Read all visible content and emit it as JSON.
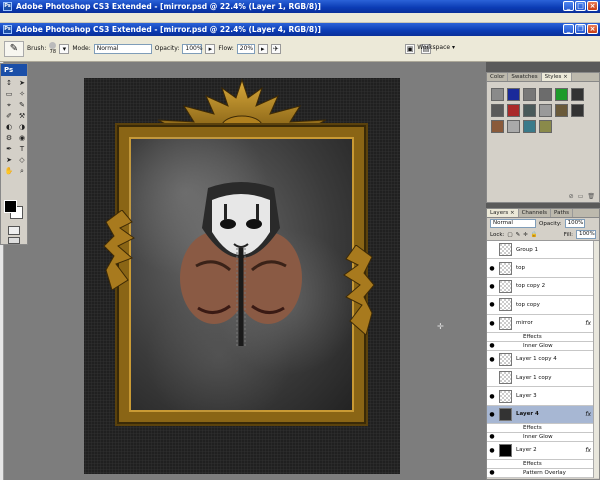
{
  "app": {
    "title": "Adobe Photoshop CS3 Extended - [mirror.psd @ 22.4% (Layer 1, RGB/8)]",
    "doc_title": "Adobe Photoshop CS3 Extended - [mirror.psd @ 22.4% (Layer 4, RGB/8)]"
  },
  "options": {
    "brush_label": "Brush:",
    "brush_size": "78",
    "mode_label": "Mode:",
    "mode_value": "Normal",
    "opacity_label": "Opacity:",
    "opacity_value": "100%",
    "flow_label": "Flow:",
    "flow_value": "20%",
    "workspace_label": "Workspace ▾"
  },
  "toolbox": {
    "logo": "Ps",
    "tools": [
      "↕",
      "➤",
      "▭",
      "✧",
      "⌖",
      "✎",
      "✐",
      "⚒",
      "◐",
      "◑",
      "⚙",
      "◉",
      "✒",
      "T",
      "➤",
      "◇",
      "✋",
      "⌕"
    ]
  },
  "styles_panel": {
    "tabs": [
      "Color",
      "Swatches",
      "Styles ×"
    ],
    "swatches": [
      "#8a8a8a",
      "#1a2a9a",
      "#777777",
      "#6c6c6c",
      "#1e9a2a",
      "#333333",
      "#5a5a5a",
      "#aa2a2a",
      "#4a5a5a",
      "#9a9a9a",
      "#6a5a3a",
      "#333333",
      "#8a5a3a",
      "#aaaaaa",
      "#3a7a8a",
      "#8a8a4a"
    ]
  },
  "layers_panel": {
    "tabs": [
      "Layers ×",
      "Channels",
      "Paths"
    ],
    "blend_mode": "Normal",
    "opacity_label": "Opacity:",
    "opacity_value": "100%",
    "lock_label": "Lock:",
    "fill_label": "Fill:",
    "fill_value": "100%",
    "layers": [
      {
        "name": "Group 1",
        "eye": false,
        "thumb": "checker",
        "fx": false,
        "selected": false,
        "sub": false
      },
      {
        "name": "top",
        "eye": true,
        "thumb": "checker",
        "fx": false,
        "selected": false,
        "sub": false
      },
      {
        "name": "top copy 2",
        "eye": true,
        "thumb": "checker",
        "fx": false,
        "selected": false,
        "sub": false
      },
      {
        "name": "top copy",
        "eye": true,
        "thumb": "checker",
        "fx": false,
        "selected": false,
        "sub": false
      },
      {
        "name": "mirror",
        "eye": true,
        "thumb": "checker",
        "fx": true,
        "selected": false,
        "sub": false
      },
      {
        "name": "Effects",
        "eye": false,
        "thumb": "none",
        "fx": false,
        "selected": false,
        "sub": true
      },
      {
        "name": "Inner Glow",
        "eye": true,
        "thumb": "none",
        "fx": false,
        "selected": false,
        "sub": true
      },
      {
        "name": "Layer 1 copy 4",
        "eye": true,
        "thumb": "checker",
        "fx": false,
        "selected": false,
        "sub": false
      },
      {
        "name": "Layer 1 copy",
        "eye": false,
        "thumb": "checker",
        "fx": false,
        "selected": false,
        "sub": false
      },
      {
        "name": "Layer 3",
        "eye": true,
        "thumb": "checker",
        "fx": false,
        "selected": false,
        "sub": false
      },
      {
        "name": "Layer 4",
        "eye": true,
        "thumb": "dark",
        "fx": true,
        "selected": true,
        "sub": false
      },
      {
        "name": "Effects",
        "eye": false,
        "thumb": "none",
        "fx": false,
        "selected": false,
        "sub": true
      },
      {
        "name": "Inner Glow",
        "eye": true,
        "thumb": "none",
        "fx": false,
        "selected": false,
        "sub": true
      },
      {
        "name": "Layer 2",
        "eye": true,
        "thumb": "black",
        "fx": true,
        "selected": false,
        "sub": false
      },
      {
        "name": "Effects",
        "eye": false,
        "thumb": "none",
        "fx": false,
        "selected": false,
        "sub": true
      },
      {
        "name": "Pattern Overlay",
        "eye": true,
        "thumb": "none",
        "fx": false,
        "selected": false,
        "sub": true
      }
    ]
  }
}
